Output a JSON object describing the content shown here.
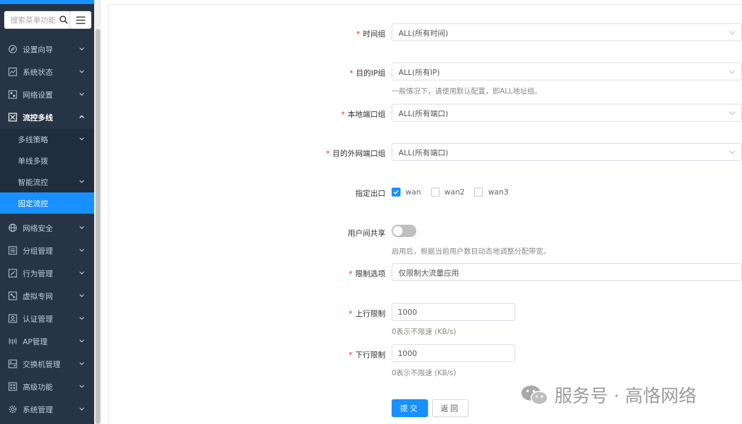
{
  "sidebar": {
    "search_placeholder": "搜索菜单功能",
    "items": [
      {
        "label": "设置向导"
      },
      {
        "label": "系统状态"
      },
      {
        "label": "网络设置"
      },
      {
        "label": "流控多线"
      },
      {
        "label": "网络安全"
      },
      {
        "label": "分组管理"
      },
      {
        "label": "行为管理"
      },
      {
        "label": "虚拟专网"
      },
      {
        "label": "认证管理"
      },
      {
        "label": "AP管理"
      },
      {
        "label": "交换机管理"
      },
      {
        "label": "高级功能"
      },
      {
        "label": "系统管理"
      }
    ],
    "subitems": [
      {
        "label": "多线策略"
      },
      {
        "label": "单线多拨"
      },
      {
        "label": "智能流控"
      },
      {
        "label": "固定流控"
      }
    ],
    "accent": "#1890ff"
  },
  "form": {
    "time_group": {
      "label": "时间组",
      "value": "ALL(所有时间)"
    },
    "dest_ip_group": {
      "label": "目的IP组",
      "value": "ALL(所有IP)",
      "hint": "一般情况下，请使用默认配置，即ALL地址组。"
    },
    "local_port_group": {
      "label": "本地端口组",
      "value": "ALL(所有端口)"
    },
    "dest_wan_port_group": {
      "label": "目的外网端口组",
      "value": "ALL(所有端口)"
    },
    "outlet": {
      "label": "指定出口",
      "options": [
        {
          "label": "wan",
          "checked": true
        },
        {
          "label": "wan2",
          "checked": false
        },
        {
          "label": "wan3",
          "checked": false
        }
      ]
    },
    "user_share": {
      "label": "用户间共享",
      "enabled": false,
      "hint": "启用后，根据当前用户数目动态地调整分配带宽。"
    },
    "limit_option": {
      "label": "限制选项",
      "value": "仅限制大流量应用"
    },
    "up_limit": {
      "label": "上行限制",
      "value": "1000",
      "hint": "0表示不限速 (KB/s)"
    },
    "down_limit": {
      "label": "下行限制",
      "value": "1000",
      "hint": "0表示不限速 (KB/s)"
    },
    "submit_label": "提交",
    "back_label": "返回"
  },
  "watermark": {
    "text": "服务号 · 高恪网络"
  }
}
